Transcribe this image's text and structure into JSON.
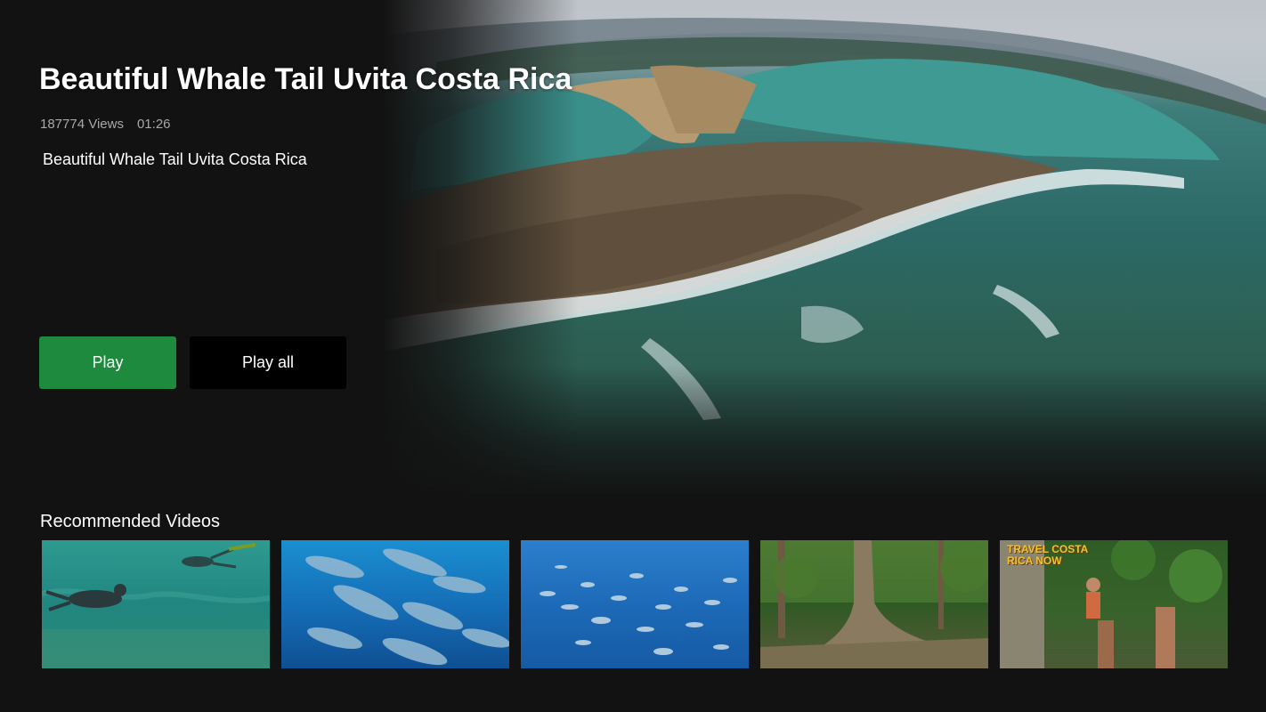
{
  "hero": {
    "title": "Beautiful Whale Tail Uvita Costa Rica",
    "views": "187774 Views",
    "duration": "01:26",
    "description": "Beautiful Whale Tail Uvita Costa Rica"
  },
  "actions": {
    "play_label": "Play",
    "play_all_label": "Play all"
  },
  "recommended": {
    "title": "Recommended Videos",
    "thumb_5_logo_line1": "TRAVEL COSTA",
    "thumb_5_logo_line2": "RICA NOW"
  },
  "colors": {
    "background": "#121212",
    "play_button": "#1e8a3e",
    "play_all_button": "#000000",
    "secondary_text": "#a8a8a8"
  }
}
